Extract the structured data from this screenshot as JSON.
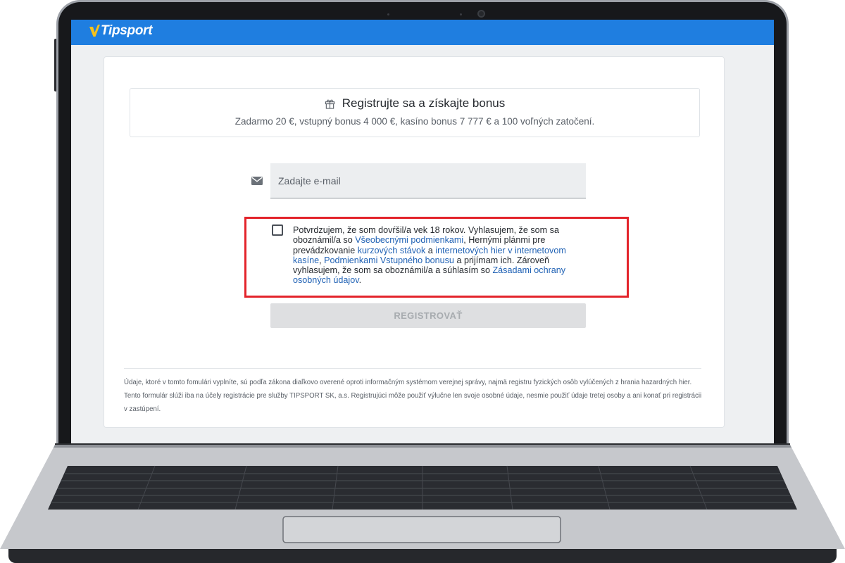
{
  "brand": {
    "name": "Tipsport",
    "bar_color": "#1f7ee0",
    "logo_mark_color": "#f6c21c"
  },
  "bonus": {
    "icon": "gift-icon",
    "title": "Registrujte sa a získajte bonus",
    "subtitle": "Zadarmo 20 €, vstupný bonus 4 000 €, kasíno bonus 7 777 € a 100 voľných zatočení."
  },
  "email": {
    "icon": "mail-icon",
    "placeholder": "Zadajte e-mail",
    "value": ""
  },
  "consent": {
    "checked": false,
    "highlight_color": "#e3242b",
    "text1": "Potvrdzujem, že som dovŕšil/a vek 18 rokov. Vyhlasujem, že som sa oboznámil/a so ",
    "link1": "Všeobecnými podmienkami",
    "text2": ", Hernými plánmi pre prevádzkovanie ",
    "link2": "kurzových stávok",
    "text3": " a ",
    "link3": "internetových hier v internetovom kasíne",
    "text4": ", ",
    "link4": "Podmienkami Vstupného bonusu",
    "text5": " a prijímam ich. Zároveň vyhlasujem, že som sa oboznámil/a a súhlasím so ",
    "link5": "Zásadami ochrany osobných údajov",
    "text6": "."
  },
  "register_button": {
    "label": "REGISTROVAŤ",
    "enabled": false
  },
  "legal_text": "Údaje, ktoré v tomto fomulári vyplníte, sú podľa zákona diaľkovo overené oproti informačným systémom verejnej správy, najmä registru fyzických osôb vylúčených z hrania hazardných hier. Tento formulár slúži iba na účely registrácie pre služby TIPSPORT SK, a.s. Registrujúci môže použiť výlučne len svoje osobné údaje, nesmie použiť údaje tretej osoby a ani konať pri registrácii v zastúpení."
}
